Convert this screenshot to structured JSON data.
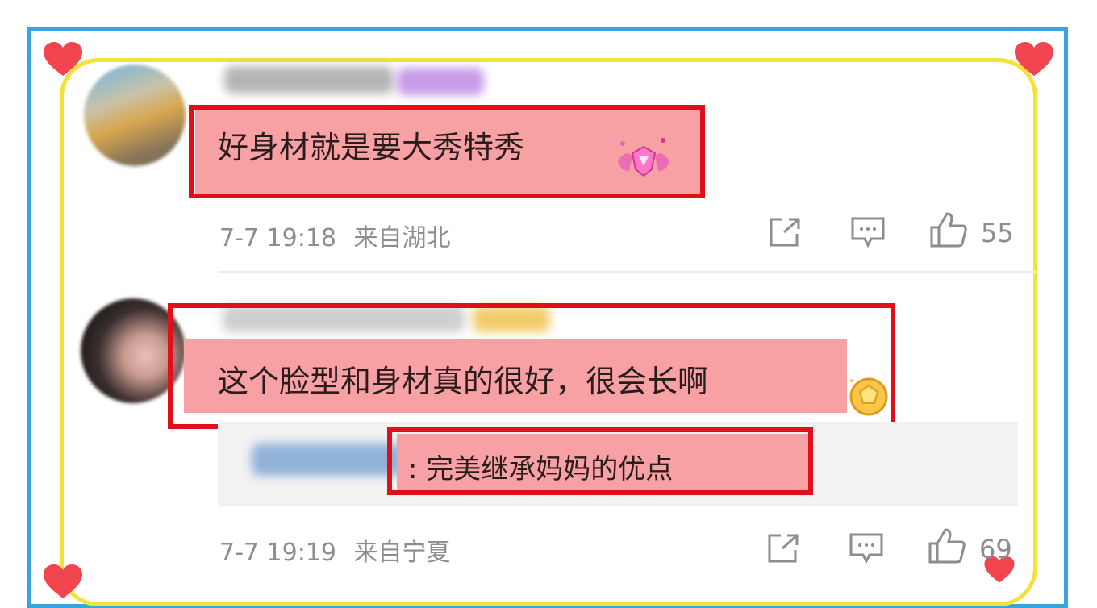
{
  "comments": [
    {
      "text": "好身材就是要大秀特秀",
      "time": "7-7 19:18",
      "location": "来自湖北",
      "likes": "55"
    },
    {
      "text": "这个脸型和身材真的很好，很会长啊",
      "time": "7-7 19:19",
      "location": "来自宁夏",
      "likes": "69",
      "reply": {
        "text": ": 完美继承妈妈的优点"
      }
    }
  ],
  "colors": {
    "frame_blue": "#39a5e0",
    "frame_yellow": "#f3e23a",
    "heart": "#f0444f",
    "highlight_pink": "#f7a1a5",
    "highlight_border": "#e10f1a"
  },
  "icons": [
    "heart-icon",
    "share-icon",
    "comment-icon",
    "like-icon",
    "vip-badge-icon",
    "fan-badge-icon"
  ]
}
